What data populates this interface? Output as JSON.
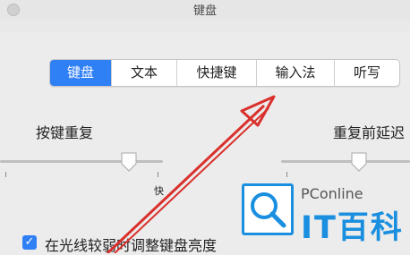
{
  "window": {
    "title": "键盘"
  },
  "tabs": [
    {
      "label": "键盘",
      "active": true
    },
    {
      "label": "文本",
      "active": false
    },
    {
      "label": "快捷键",
      "active": false
    },
    {
      "label": "输入法",
      "active": false
    },
    {
      "label": "听写",
      "active": false
    }
  ],
  "settings": {
    "key_repeat_label": "按键重复",
    "delay_label": "重复前延迟",
    "slider_fast_label": "快"
  },
  "checkbox": {
    "label": "在光线较弱时调整键盘亮度",
    "checked": true
  },
  "watermark": {
    "brand_small": "PConline",
    "brand_big": "IT百科"
  },
  "colors": {
    "accent": "#2f7ff5",
    "annotation_arrow": "#d9302c",
    "watermark": "#1a8fe0"
  }
}
